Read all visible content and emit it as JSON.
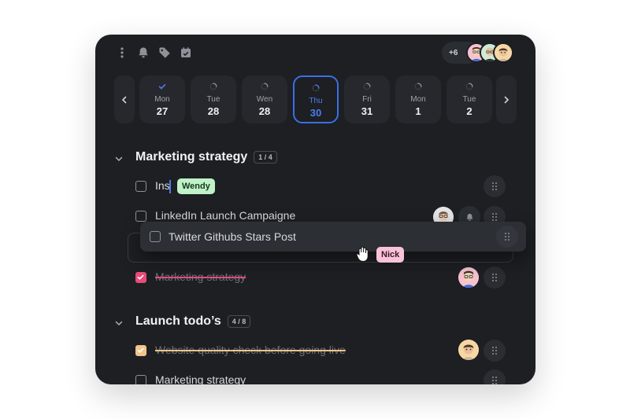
{
  "toolbar": {
    "icons": [
      "kebab-menu-icon",
      "bell-icon",
      "tag-icon",
      "calendar-check-icon"
    ]
  },
  "collaborators": {
    "more_count": "+6"
  },
  "calendar": {
    "days": [
      {
        "name": "Mon",
        "num": "27",
        "state": "done"
      },
      {
        "name": "Tue",
        "num": "28",
        "state": "pending"
      },
      {
        "name": "Wen",
        "num": "28",
        "state": "pending"
      },
      {
        "name": "Thu",
        "num": "30",
        "state": "active"
      },
      {
        "name": "Fri",
        "num": "31",
        "state": "pending"
      },
      {
        "name": "Mon",
        "num": "1",
        "state": "pending"
      },
      {
        "name": "Tue",
        "num": "2",
        "state": "pending"
      }
    ]
  },
  "sections": [
    {
      "title": "Marketing strategy",
      "count": "1 / 4",
      "tasks": [
        {
          "label": "Ins",
          "tag": "Wendy",
          "done": false
        },
        {
          "label": "LinkedIn Launch Campaigne",
          "done": false
        },
        {
          "label": "Marketing strategy",
          "done": true
        }
      ]
    },
    {
      "title": "Launch todo’s",
      "count": "4 / 8",
      "tasks": [
        {
          "label": "Website quality check before going live",
          "done": true
        },
        {
          "label": "Marketing strategy",
          "done": false
        }
      ]
    }
  ],
  "drag": {
    "label": "Twitter Githubs Stars Post",
    "cursor_tag": "Nick"
  },
  "colors": {
    "card_bg": "#1d1f23",
    "accent_blue": "#3b6ee8",
    "checked_pink": "#e94c7a",
    "checked_peach": "#f3c48a",
    "tag_green": "#bff2c7",
    "tag_pink": "#f9c3d7"
  }
}
